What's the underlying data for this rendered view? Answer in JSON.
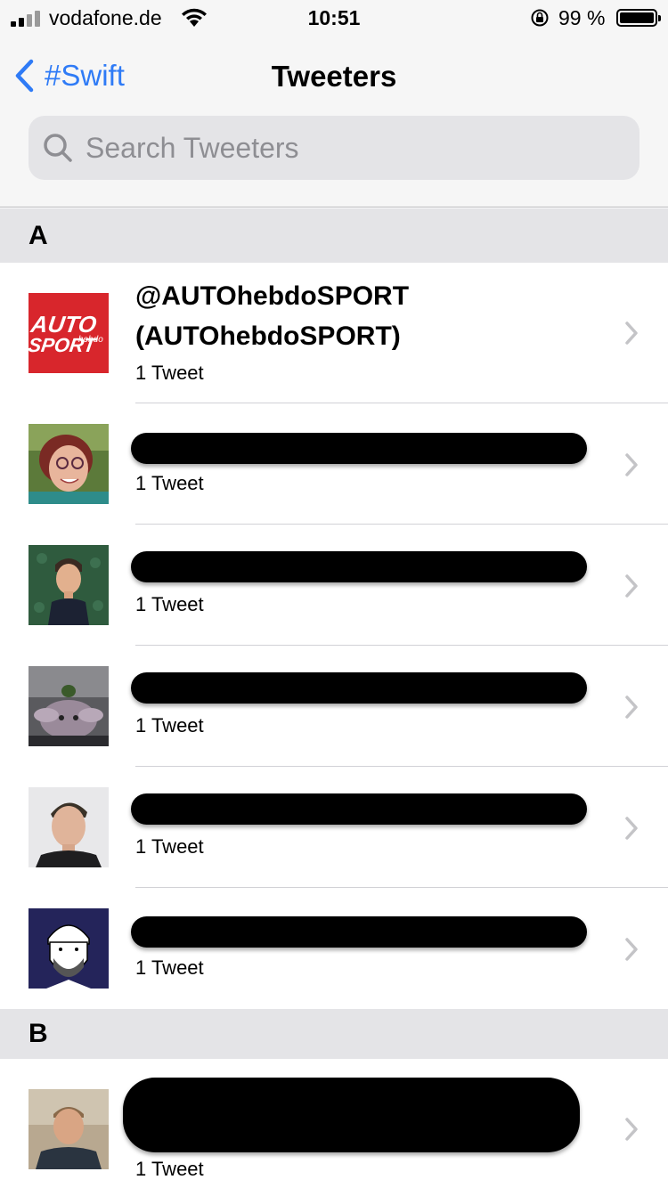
{
  "status_bar": {
    "carrier": "vodafone.de",
    "time": "10:51",
    "battery": "99 %",
    "icons": [
      "signal-icon",
      "wifi-icon",
      "orientation-lock-icon",
      "battery-icon"
    ]
  },
  "nav": {
    "back_label": "#Swift",
    "title": "Tweeters"
  },
  "search": {
    "placeholder": "Search Tweeters"
  },
  "sections": [
    {
      "letter": "A",
      "rows": [
        {
          "name_line1": "@AUTOhebdoSPORT",
          "name_line2": "(AUTOhebdoSPORT)",
          "count": "1 Tweet",
          "avatar": "auto-hebdo-sport-logo"
        },
        {
          "name_line1": "",
          "count": "1 Tweet",
          "avatar": "woman-photo",
          "redacted": true
        },
        {
          "name_line1": "",
          "count": "1 Tweet",
          "avatar": "bitmoji-avatar",
          "redacted": true
        },
        {
          "name_line1": "",
          "count": "1 Tweet",
          "avatar": "creature-photo",
          "redacted": true
        },
        {
          "name_line1": "",
          "count": "1 Tweet",
          "avatar": "man-photo",
          "redacted": true
        },
        {
          "name_line1": "",
          "count": "1 Tweet",
          "avatar": "illustrated-man",
          "redacted": true
        }
      ]
    },
    {
      "letter": "B",
      "rows": [
        {
          "name_line1": "",
          "count": "1 Tweet",
          "avatar": "man-photo-2",
          "redacted": true
        }
      ]
    }
  ],
  "logo": {
    "top": "AUTO",
    "mid": "hebdo",
    "bottom": "SPORT"
  }
}
